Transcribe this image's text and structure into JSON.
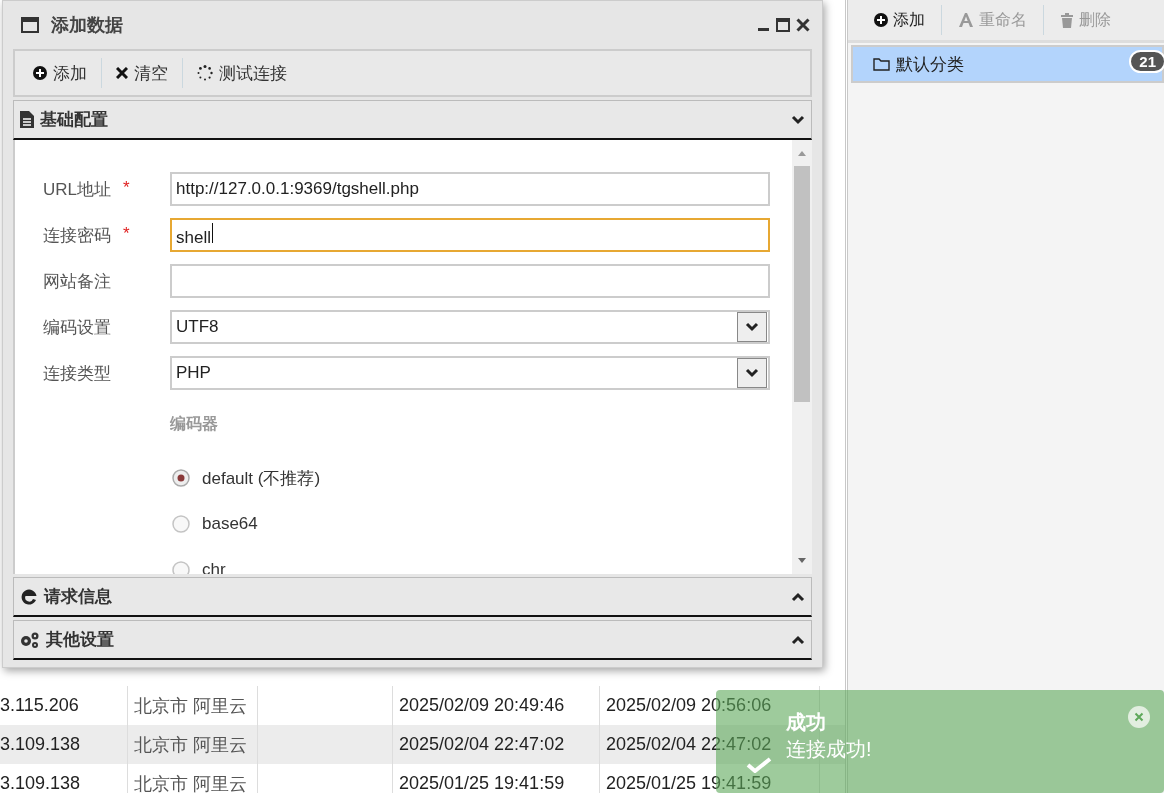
{
  "window": {
    "title": "添加数据"
  },
  "toolbar": [
    {
      "label": "添加",
      "kind": "add"
    },
    {
      "label": "清空",
      "kind": "clear"
    },
    {
      "label": "测试连接",
      "kind": "test"
    }
  ],
  "sections": [
    {
      "title": "基础配置",
      "kind": "doc",
      "expanded": true
    },
    {
      "title": "请求信息",
      "kind": "ie",
      "expanded": false
    },
    {
      "title": "其他设置",
      "kind": "gears",
      "expanded": false
    }
  ],
  "form": {
    "required_mark": "*",
    "fields": [
      {
        "label": "URL地址",
        "required": true,
        "kind": "text",
        "value": "http://127.0.0.1:9369/tgshell.php",
        "focused": false
      },
      {
        "label": "连接密码",
        "required": true,
        "kind": "text",
        "value": "shell",
        "focused": true
      },
      {
        "label": "网站备注",
        "required": false,
        "kind": "text",
        "focused": false
      },
      {
        "label": "编码设置",
        "required": false,
        "kind": "select",
        "value": "UTF8",
        "focused": false
      },
      {
        "label": "连接类型",
        "required": false,
        "kind": "select",
        "value": "PHP",
        "focused": false
      }
    ],
    "encoder": {
      "title": "编码器",
      "options": [
        {
          "label": "default (不推荐)",
          "selected": true
        },
        {
          "label": "base64",
          "selected": false
        },
        {
          "label": "chr",
          "selected": false
        }
      ]
    }
  },
  "table": {
    "rows": [
      [
        "3.115.206",
        "北京市 阿里云",
        "2025/02/09 20:49:46",
        "2025/02/09 20:56:06"
      ],
      [
        "3.109.138",
        "北京市 阿里云",
        "2025/02/04 22:47:02",
        "2025/02/04 22:47:02"
      ],
      [
        "3.109.138",
        "北京市 阿里云",
        "2025/01/25 19:41:59",
        "2025/01/25 19:41:59"
      ]
    ]
  },
  "categories": {
    "toolbar": [
      {
        "label": "添加",
        "kind": "add",
        "disabled": false
      },
      {
        "label": "重命名",
        "kind": "rename",
        "disabled": true
      },
      {
        "label": "删除",
        "kind": "delete",
        "disabled": true
      }
    ],
    "items": [
      {
        "label": "默认分类",
        "count": "21",
        "selected": true
      }
    ]
  },
  "toast": {
    "title": "成功",
    "message": "连接成功!"
  }
}
